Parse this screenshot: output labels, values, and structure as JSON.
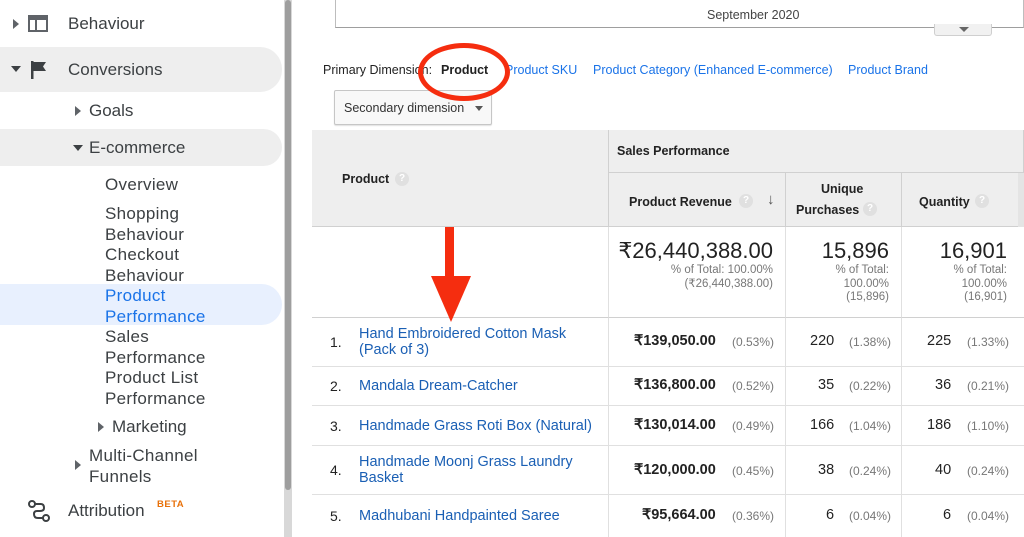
{
  "sidebar": {
    "behaviour": "Behaviour",
    "conversions": "Conversions",
    "goals": "Goals",
    "ecommerce": "E-commerce",
    "overview": "Overview",
    "shopping_behaviour": [
      "Shopping",
      "Behaviour"
    ],
    "checkout_behaviour": [
      "Checkout",
      "Behaviour"
    ],
    "product_performance": [
      "Product",
      "Performance"
    ],
    "sales_performance": [
      "Sales",
      "Performance"
    ],
    "product_list_performance": [
      "Product List",
      "Performance"
    ],
    "marketing": "Marketing",
    "multi_channel_funnels": [
      "Multi-Channel",
      "Funnels"
    ],
    "attribution": "Attribution",
    "beta_badge": "BETA"
  },
  "chart": {
    "month_label": "September 2020"
  },
  "dimensions": {
    "label": "Primary Dimension:",
    "selected": "Product",
    "options": [
      "Product SKU",
      "Product Category (Enhanced E-commerce)",
      "Product Brand"
    ]
  },
  "secondary_dimension": {
    "label": "Secondary dimension"
  },
  "table": {
    "group_header": "Sales Performance",
    "columns": {
      "product": "Product",
      "revenue": "Product Revenue",
      "unique": [
        "Unique",
        "Purchases"
      ],
      "quantity": "Quantity"
    },
    "help_glyph": "?",
    "totals": {
      "revenue": "₹26,440,388.00",
      "revenue_pct": "% of Total: 100.00%",
      "revenue_base": "(₹26,440,388.00)",
      "unique": "15,896",
      "unique_pct": [
        "% of Total:",
        "100.00%",
        "(15,896)"
      ],
      "quantity": "16,901",
      "quantity_pct": [
        "% of Total:",
        "100.00%",
        "(16,901)"
      ]
    },
    "rows": [
      {
        "num": "1.",
        "name": "Hand Embroidered Cotton Mask (Pack of 3)",
        "revenue": "₹139,050.00",
        "revenue_pct": "(0.53%)",
        "unique": "220",
        "unique_pct": "(1.38%)",
        "qty": "225",
        "qty_pct": "(1.33%)"
      },
      {
        "num": "2.",
        "name": "Mandala Dream-Catcher",
        "revenue": "₹136,800.00",
        "revenue_pct": "(0.52%)",
        "unique": "35",
        "unique_pct": "(0.22%)",
        "qty": "36",
        "qty_pct": "(0.21%)"
      },
      {
        "num": "3.",
        "name": "Handmade Grass Roti Box (Natural)",
        "revenue": "₹130,014.00",
        "revenue_pct": "(0.49%)",
        "unique": "166",
        "unique_pct": "(1.04%)",
        "qty": "186",
        "qty_pct": "(1.10%)"
      },
      {
        "num": "4.",
        "name": "Handmade Moonj Grass Laundry Basket",
        "revenue": "₹120,000.00",
        "revenue_pct": "(0.45%)",
        "unique": "38",
        "unique_pct": "(0.24%)",
        "qty": "40",
        "qty_pct": "(0.24%)"
      },
      {
        "num": "5.",
        "name": "Madhubani Handpainted Saree",
        "revenue": "₹95,664.00",
        "revenue_pct": "(0.36%)",
        "unique": "6",
        "unique_pct": "(0.04%)",
        "qty": "6",
        "qty_pct": "(0.04%)"
      }
    ]
  },
  "colors": {
    "annotation": "#f52d0f",
    "link": "#1a73e8",
    "header_bg": "#eeeeee"
  }
}
